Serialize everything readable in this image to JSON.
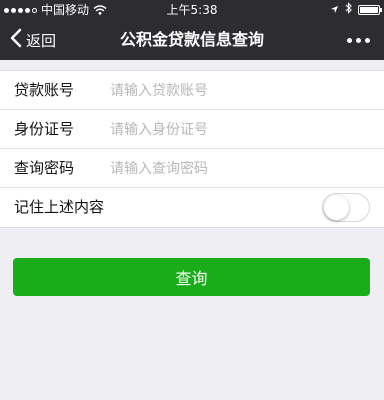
{
  "status_bar": {
    "carrier": "中国移动",
    "time": "上午5:38",
    "signal_bars_filled": 4,
    "signal_bars_total": 5,
    "battery_level": 1.0
  },
  "nav": {
    "back_label": "返回",
    "title": "公积金贷款信息查询"
  },
  "form": {
    "fields": [
      {
        "label": "贷款账号",
        "placeholder": "请输入贷款账号"
      },
      {
        "label": "身份证号",
        "placeholder": "请输入身份证号"
      },
      {
        "label": "查询密码",
        "placeholder": "请输入查询密码"
      }
    ],
    "remember_label": "记住上述内容",
    "remember_on": false
  },
  "submit_label": "查询",
  "colors": {
    "nav_bg": "#2d2d31",
    "page_bg": "#eeeef3",
    "button_green": "#1aad19",
    "placeholder": "#b8b8b8"
  }
}
